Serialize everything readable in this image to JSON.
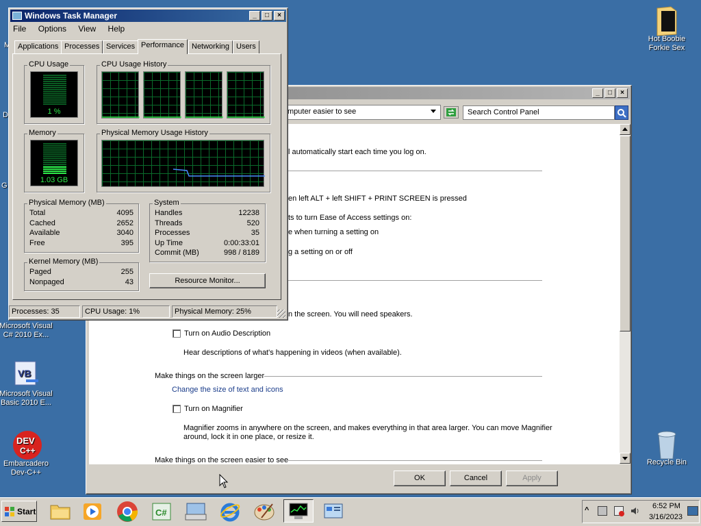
{
  "desktop": {
    "icons": [
      {
        "label": "Hot Boobie Forkie Sex"
      },
      {
        "label": "Microsoft Visual C# 2010 Ex..."
      },
      {
        "label": "Microsoft Visual Basic 2010 E..."
      },
      {
        "label": "Embarcadero Dev-C++"
      },
      {
        "label": "Recycle Bin"
      }
    ],
    "edge_labels": [
      "M",
      "D",
      "G"
    ]
  },
  "control_panel": {
    "address_text": "mputer easier to see",
    "search_placeholder": "Search Control Panel",
    "lines": {
      "auto_start": "l automatically start each time you log on.",
      "alt_shift": "en left ALT + left SHIFT + PRINT SCREEN is pressed",
      "turn_settings": "ts to turn Ease of Access settings on:",
      "when_turning": "e when turning a setting on",
      "setting_on_off": "g a setting on or off",
      "speakers": "n the screen. You will need speakers.",
      "audio_desc_hint": "Hear descriptions of what's happening in videos (when available).",
      "magnifier_hint_1": "Magnifier zooms in anywhere on the screen, and makes everything in that area larger. You can move Magnifier",
      "magnifier_hint_2": "around, lock it in one place, or resize it."
    },
    "audio_desc_label": "Turn on Audio Description",
    "larger_heading": "Make things on the screen larger",
    "text_size_link": "Change the size of text and icons",
    "magnifier_label": "Turn on Magnifier",
    "easier_heading": "Make things on the screen easier to see",
    "buttons": {
      "ok": "OK",
      "cancel": "Cancel",
      "apply": "Apply"
    }
  },
  "task_manager": {
    "title": "Windows Task Manager",
    "menu": [
      "File",
      "Options",
      "View",
      "Help"
    ],
    "tabs": [
      "Applications",
      "Processes",
      "Services",
      "Performance",
      "Networking",
      "Users"
    ],
    "selected_tab": "Performance",
    "cpu_usage_label": "CPU Usage",
    "cpu_usage_value": "1 %",
    "cpu_history_label": "CPU Usage History",
    "memory_label": "Memory",
    "memory_value": "1.03 GB",
    "mem_history_label": "Physical Memory Usage History",
    "physical_memory": {
      "label": "Physical Memory (MB)",
      "rows": [
        {
          "name": "Total",
          "value": "4095"
        },
        {
          "name": "Cached",
          "value": "2652"
        },
        {
          "name": "Available",
          "value": "3040"
        },
        {
          "name": "Free",
          "value": "395"
        }
      ]
    },
    "system": {
      "label": "System",
      "rows": [
        {
          "name": "Handles",
          "value": "12238"
        },
        {
          "name": "Threads",
          "value": "520"
        },
        {
          "name": "Processes",
          "value": "35"
        },
        {
          "name": "Up Time",
          "value": "0:00:33:01"
        },
        {
          "name": "Commit (MB)",
          "value": "998 / 8189"
        }
      ]
    },
    "kernel_memory": {
      "label": "Kernel Memory (MB)",
      "rows": [
        {
          "name": "Paged",
          "value": "255"
        },
        {
          "name": "Nonpaged",
          "value": "43"
        }
      ]
    },
    "resource_monitor_button": "Resource Monitor...",
    "status": {
      "processes": "Processes: 35",
      "cpu": "CPU Usage: 1%",
      "memory": "Physical Memory: 25%"
    }
  },
  "taskbar": {
    "start_label": "Start",
    "clock_time": "6:52 PM",
    "clock_date": "3/16/2023"
  }
}
